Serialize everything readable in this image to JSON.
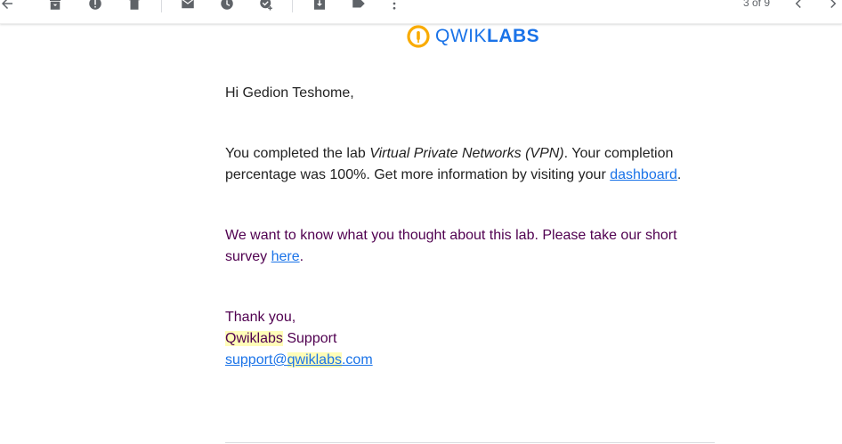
{
  "toolbar": {
    "icons": [
      "back-icon",
      "archive-icon",
      "report-spam-icon",
      "delete-icon",
      "mark-unread-icon",
      "snooze-icon",
      "add-to-tasks-icon",
      "move-to-icon",
      "labels-icon",
      "more-icon"
    ],
    "page_count": "3 of 9"
  },
  "logo": {
    "word_thin": "QWIK",
    "word_bold": "LABS",
    "colors": {
      "ring": "#f9ab00",
      "text": "#1a73e8"
    }
  },
  "email": {
    "greeting": "Hi Gedion Teshome,",
    "para1": {
      "line1_pre": "You completed the lab ",
      "lab_name": "Virtual Private Networks (VPN)",
      "line1_post": ". Your completion",
      "line2_pre": "percentage was 100%. Get more information by visiting your ",
      "dashboard_link": "dashboard",
      "line2_post": "."
    },
    "para2": {
      "line1": "We want to know what you thought about this lab. Please take our short",
      "line2_pre": "survey ",
      "here_link": "here",
      "line2_post": "."
    },
    "signoff": {
      "thanks": "Thank you,",
      "company_highlight": "Qwiklabs",
      "company_rest": " Support",
      "email_pre": "support@",
      "email_highlight": "qwiklabs",
      "email_post": ".com"
    }
  },
  "colors": {
    "link": "#1a73e8",
    "quoted_text": "#500050",
    "highlight": "#fffdb8"
  }
}
